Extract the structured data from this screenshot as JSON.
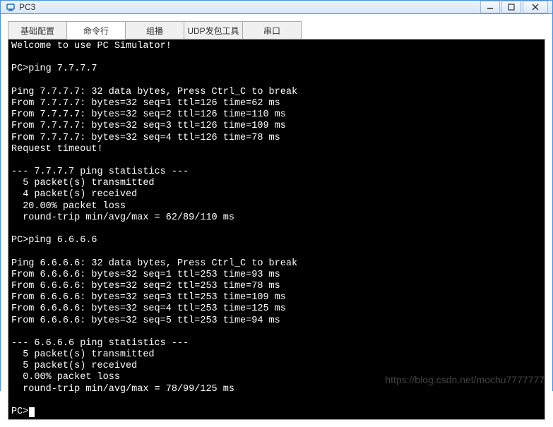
{
  "window": {
    "title": "PC3"
  },
  "tabs": [
    {
      "label": "基础配置"
    },
    {
      "label": "命令行"
    },
    {
      "label": "组播"
    },
    {
      "label": "UDP发包工具"
    },
    {
      "label": "串口"
    }
  ],
  "terminal": {
    "lines": [
      "Welcome to use PC Simulator!",
      "",
      "PC>ping 7.7.7.7",
      "",
      "Ping 7.7.7.7: 32 data bytes, Press Ctrl_C to break",
      "From 7.7.7.7: bytes=32 seq=1 ttl=126 time=62 ms",
      "From 7.7.7.7: bytes=32 seq=2 ttl=126 time=110 ms",
      "From 7.7.7.7: bytes=32 seq=3 ttl=126 time=109 ms",
      "From 7.7.7.7: bytes=32 seq=4 ttl=126 time=78 ms",
      "Request timeout!",
      "",
      "--- 7.7.7.7 ping statistics ---",
      "  5 packet(s) transmitted",
      "  4 packet(s) received",
      "  20.00% packet loss",
      "  round-trip min/avg/max = 62/89/110 ms",
      "",
      "PC>ping 6.6.6.6",
      "",
      "Ping 6.6.6.6: 32 data bytes, Press Ctrl_C to break",
      "From 6.6.6.6: bytes=32 seq=1 ttl=253 time=93 ms",
      "From 6.6.6.6: bytes=32 seq=2 ttl=253 time=78 ms",
      "From 6.6.6.6: bytes=32 seq=3 ttl=253 time=109 ms",
      "From 6.6.6.6: bytes=32 seq=4 ttl=253 time=125 ms",
      "From 6.6.6.6: bytes=32 seq=5 ttl=253 time=94 ms",
      "",
      "--- 6.6.6.6 ping statistics ---",
      "  5 packet(s) transmitted",
      "  5 packet(s) received",
      "  0.00% packet loss",
      "  round-trip min/avg/max = 78/99/125 ms",
      "",
      "PC>"
    ]
  },
  "watermark": "https://blog.csdn.net/mochu7777777"
}
